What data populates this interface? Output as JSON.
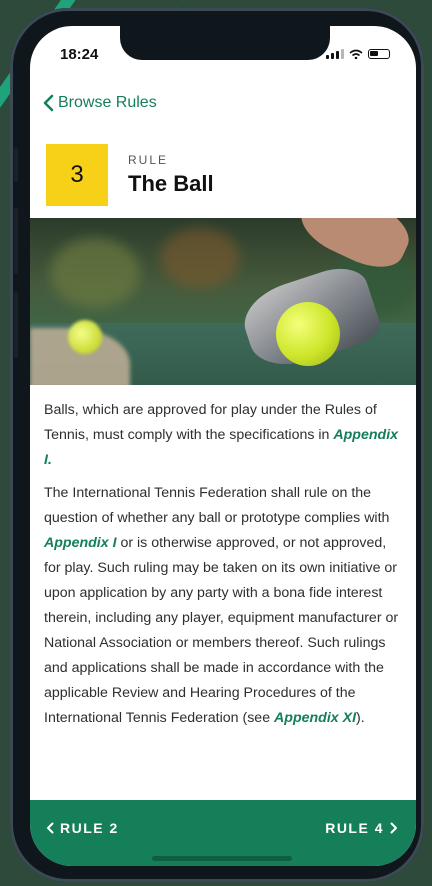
{
  "status": {
    "time": "18:24"
  },
  "nav": {
    "back_label": "Browse Rules"
  },
  "rule": {
    "number": "3",
    "label": "RULE",
    "title": "The Ball"
  },
  "body": {
    "p1_before": "Balls, which are approved for play under the Rules of Tennis, must comply with the specifications in ",
    "p1_link": "Appendix I.",
    "p2_before": "The International Tennis Federation shall rule on the question of whether any ball or prototype complies with ",
    "p2_link": "Appendix I",
    "p2_middle": " or is otherwise approved, or not approved, for play. Such ruling may be taken on its own initiative or upon application by any party with a bona fide interest therein, including any player, equipment manufacturer or National Association or members thereof. Such rulings and applications shall be made in accordance with the applicable Review and Hearing Procedures of the International Tennis Federation (see ",
    "p2_link2": "Appendix XI",
    "p2_after": ")."
  },
  "footer": {
    "prev_label": "RULE 2",
    "next_label": "RULE 4"
  },
  "colors": {
    "accent": "#157f5a",
    "rule_badge": "#f7d117"
  },
  "icons": {
    "back": "chevron-left-icon",
    "prev": "chevron-left-icon",
    "next": "chevron-right-icon"
  }
}
